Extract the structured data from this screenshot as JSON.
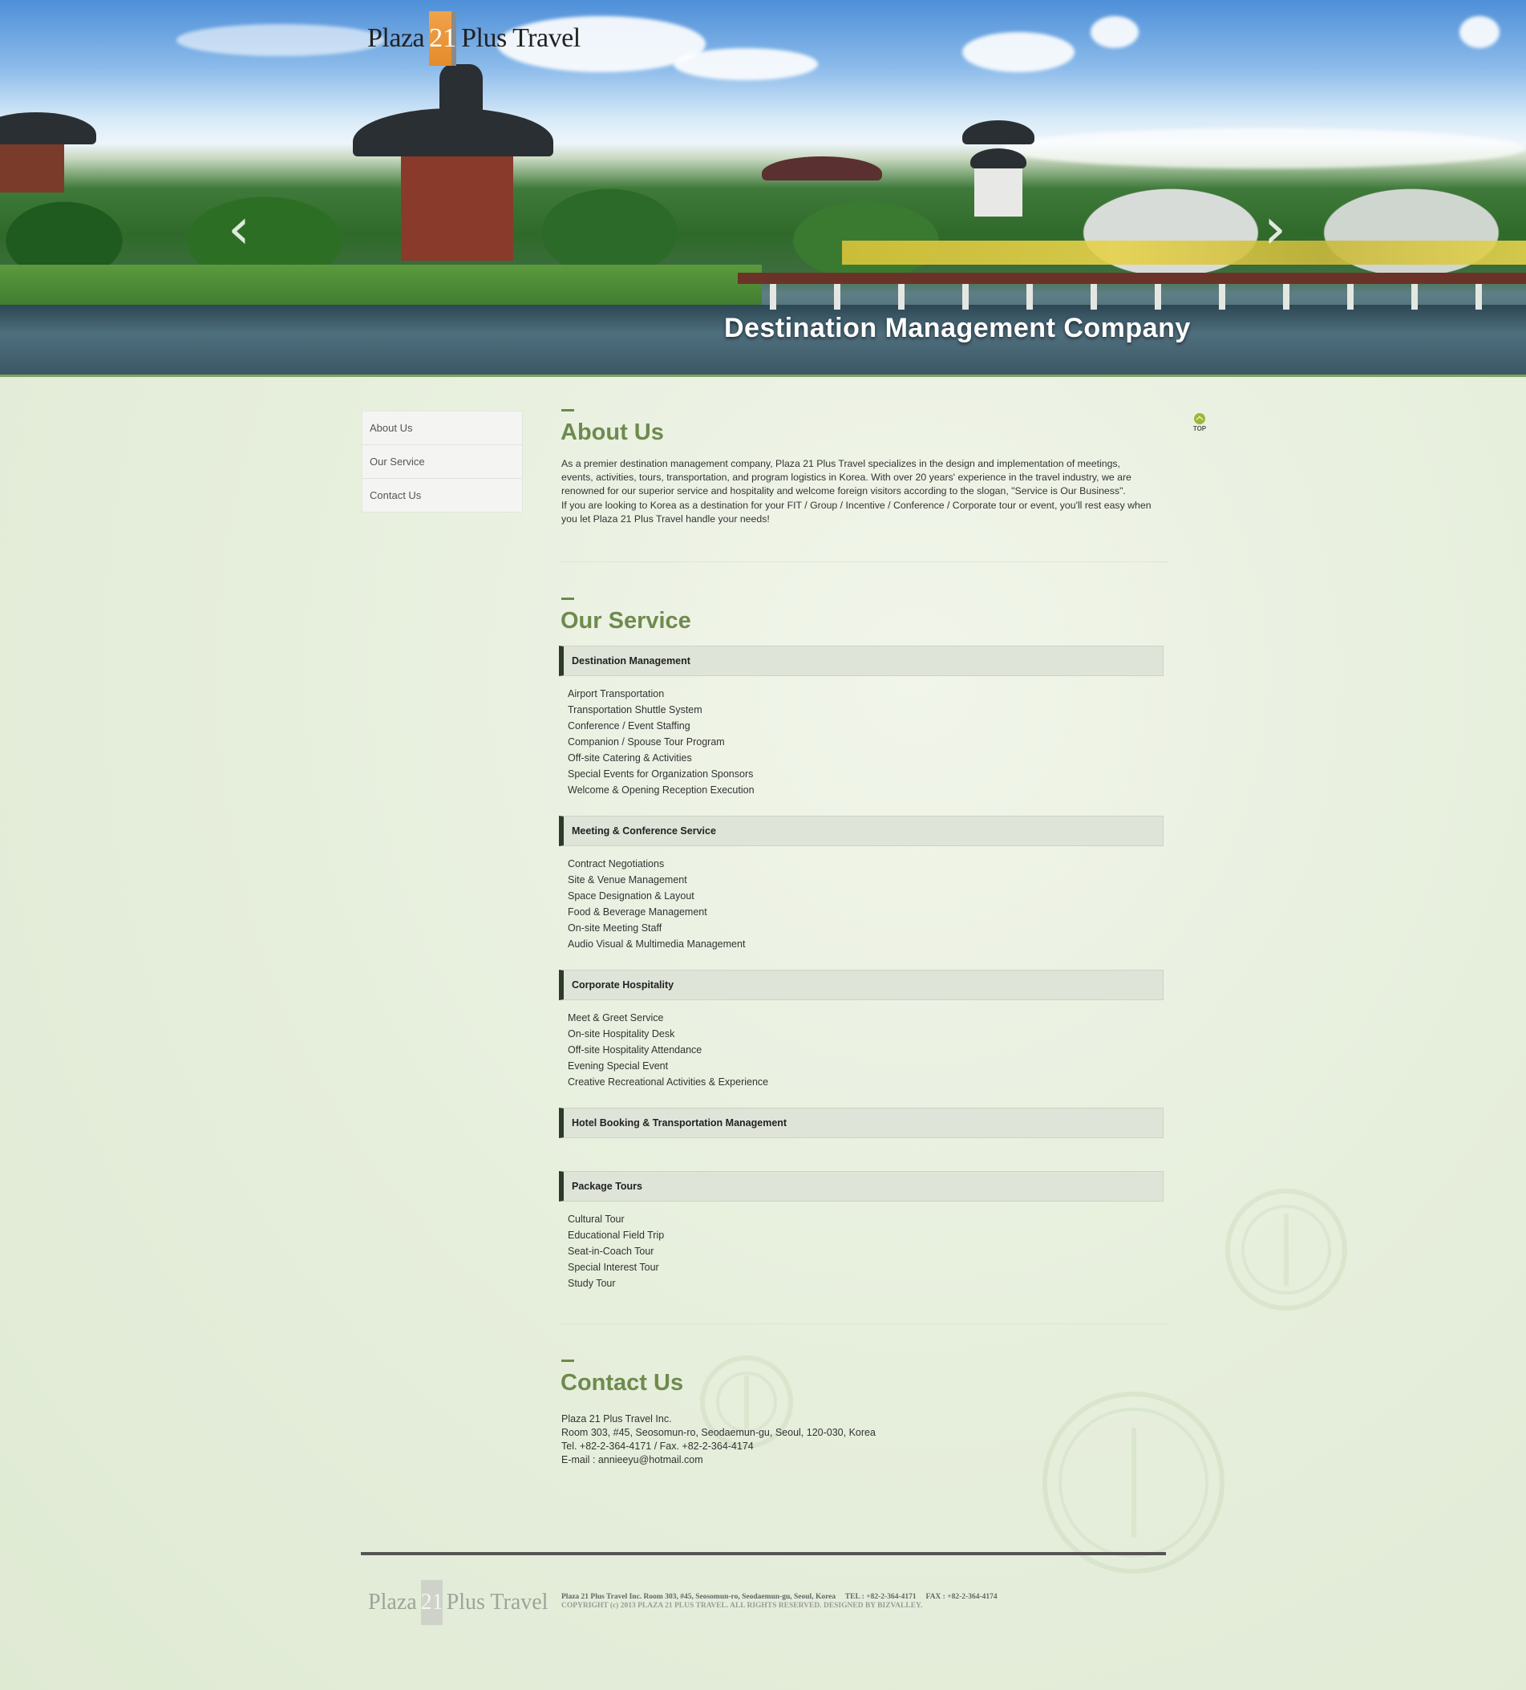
{
  "header": {
    "logo": {
      "word1": "Plaza",
      "number": "21",
      "word2": "Plus Travel"
    },
    "slogan": "Destination Management Company",
    "prev_arrow": "‹",
    "next_arrow": "›"
  },
  "sidebar": {
    "items": [
      {
        "label": "About Us"
      },
      {
        "label": "Our Service"
      },
      {
        "label": "Contact Us"
      }
    ]
  },
  "top_button": {
    "label": "TOP",
    "icon": "arrow-up-circle-icon"
  },
  "about": {
    "title": "About Us",
    "paragraph1": "As a premier destination management company, Plaza 21 Plus Travel specializes in the design and implementation of meetings, events, activities, tours, transportation, and program logistics in Korea. With over 20 years' experience in the travel industry, we are renowned for our superior service and hospitality and welcome foreign visitors according to the slogan, \"Service is Our Business\".",
    "paragraph2": "If you are looking to Korea as a destination for your FIT / Group / Incentive / Conference / Corporate tour or event, you'll rest easy when you let Plaza 21 Plus Travel handle your needs!"
  },
  "service": {
    "title": "Our Service",
    "groups": [
      {
        "heading": "Destination Management",
        "items": [
          "Airport Transportation",
          "Transportation Shuttle System",
          "Conference / Event Staffing",
          "Companion / Spouse Tour Program",
          "Off-site Catering & Activities",
          "Special Events for Organization Sponsors",
          "Welcome & Opening Reception Execution"
        ]
      },
      {
        "heading": "Meeting & Conference Service",
        "items": [
          "Contract Negotiations",
          "Site & Venue Management",
          "Space Designation & Layout",
          "Food & Beverage Management",
          "On-site Meeting Staff",
          "Audio Visual & Multimedia Management"
        ]
      },
      {
        "heading": "Corporate Hospitality",
        "items": [
          "Meet & Greet Service",
          "On-site Hospitality Desk",
          "Off-site Hospitality Attendance",
          "Evening Special Event",
          "Creative Recreational Activities & Experience"
        ]
      },
      {
        "heading": "Hotel Booking & Transportation Management",
        "items": []
      },
      {
        "heading": "Package Tours",
        "items": [
          "Cultural Tour",
          "Educational Field Trip",
          "Seat-in-Coach Tour",
          "Special Interest Tour",
          "Study Tour"
        ]
      }
    ]
  },
  "contact": {
    "title": "Contact Us",
    "company": "Plaza 21 Plus Travel Inc.",
    "address": "Room 303, #45, Seosomun-ro, Seodaemun-gu, Seoul, 120-030, Korea",
    "phone": "Tel. +82-2-364-4171 / Fax. +82-2-364-4174",
    "email": "E-mail : annieeyu@hotmail.com"
  },
  "footer": {
    "logo": {
      "word1": "Plaza",
      "number": "21",
      "word2": "Plus Travel"
    },
    "info": "Plaza 21 Plus Travel Inc. Room 303, #45, Seosomun-ro, Seodaemun-gu, Seoul, Korea     TEL : +82-2-364-4171     FAX : +82-2-364-4174",
    "copyright": "COPYRIGHT (c) 2013 PLAZA 21 PLUS TRAVEL. ALL RIGHTS RESERVED. DESIGNED BY BIZVALLEY."
  },
  "colors": {
    "accent_green": "#6e8b4d",
    "logo_orange": "#e48b2b",
    "service_header_bg": "#dfe4d8",
    "service_header_bar": "#2d3a2a",
    "top_button": "#9bb83a"
  }
}
